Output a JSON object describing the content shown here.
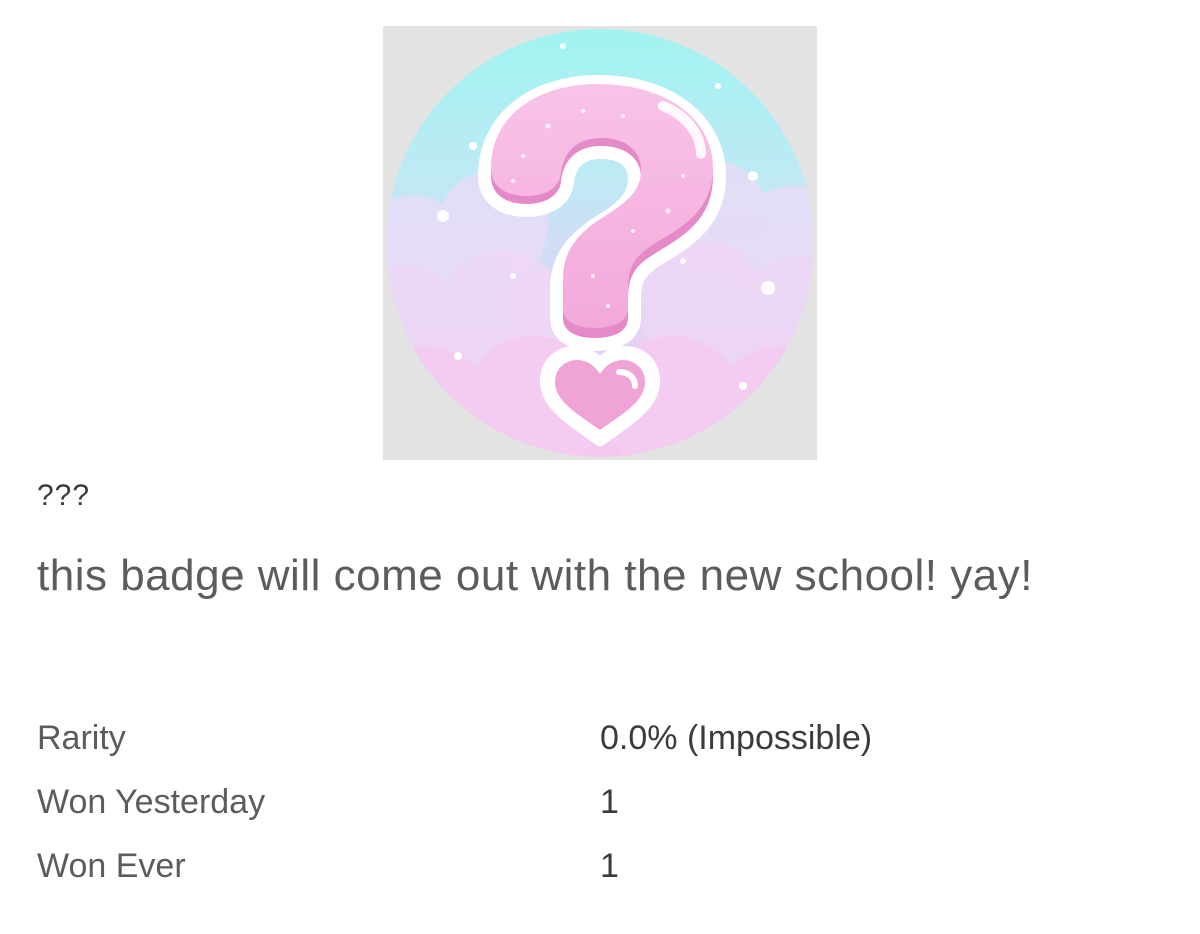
{
  "badge": {
    "icon": "question-mark-heart-badge-icon",
    "name": "???",
    "description": "this badge will come out with the new school! yay!"
  },
  "stats": [
    {
      "label": "Rarity",
      "value": "0.0% (Impossible)"
    },
    {
      "label": "Won Yesterday",
      "value": "1"
    },
    {
      "label": "Won Ever",
      "value": "1"
    }
  ],
  "colors": {
    "frame_bg": "#e3e3e3",
    "sky_top": "#9ff4f2",
    "sky_bottom": "#f6c6ee",
    "question_pink": "#f5b2e0",
    "question_shadow": "#e58ac8",
    "text_dark": "#393b3d",
    "text_muted": "#5a5c5e"
  }
}
